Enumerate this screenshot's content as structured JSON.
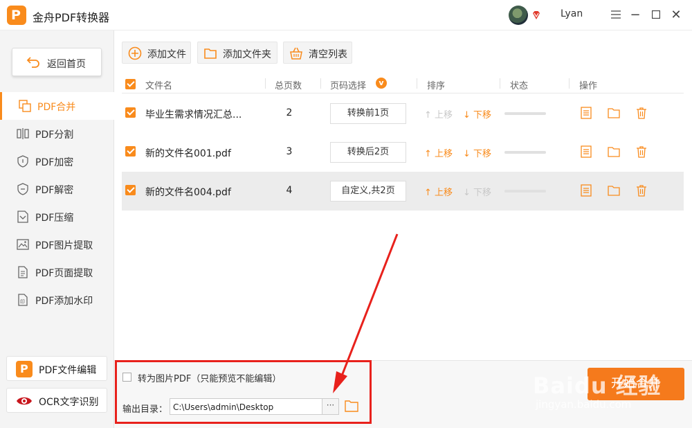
{
  "titlebar": {
    "app_title": "金舟PDF转换器",
    "username": "Lyan",
    "min_glyph": "−",
    "max_glyph": "☐",
    "close_glyph": "✕"
  },
  "sidebar": {
    "back_label": "返回首页",
    "items": [
      {
        "label": "PDF合并",
        "icon": "merge-icon",
        "active": true
      },
      {
        "label": "PDF分割",
        "icon": "split-icon"
      },
      {
        "label": "PDF加密",
        "icon": "shield-lock-icon"
      },
      {
        "label": "PDF解密",
        "icon": "shield-unlock-icon"
      },
      {
        "label": "PDF压缩",
        "icon": "compress-icon"
      },
      {
        "label": "PDF图片提取",
        "icon": "image-icon"
      },
      {
        "label": "PDF页面提取",
        "icon": "page-icon"
      },
      {
        "label": "PDF添加水印",
        "icon": "watermark-icon"
      }
    ],
    "tools": [
      {
        "label": "PDF文件编辑",
        "icon": "pdf-edit-icon"
      },
      {
        "label": "OCR文字识别",
        "icon": "eye-icon"
      }
    ]
  },
  "toolbar": {
    "add_file": "添加文件",
    "add_folder": "添加文件夹",
    "clear_list": "清空列表"
  },
  "table": {
    "headers": {
      "filename": "文件名",
      "pages": "总页数",
      "page_select": "页码选择",
      "order": "排序",
      "status": "状态",
      "actions": "操作"
    },
    "page_select_badge": "v",
    "move_up": "上移",
    "move_down": "下移",
    "rows": [
      {
        "name": "毕业生需求情况汇总...",
        "pages": "2",
        "page_range": "转换前1页",
        "up_enabled": false,
        "down_enabled": true,
        "selected": false
      },
      {
        "name": "新的文件名001.pdf",
        "pages": "3",
        "page_range": "转换后2页",
        "up_enabled": true,
        "down_enabled": true,
        "selected": false
      },
      {
        "name": "新的文件名004.pdf",
        "pages": "4",
        "page_range": "自定义,共2页",
        "up_enabled": true,
        "down_enabled": false,
        "selected": true
      }
    ]
  },
  "bottom": {
    "to_image_pdf_label": "转为图片PDF（只能预览不能编辑）",
    "output_dir_label": "输出目录：",
    "output_dir_value": "C:\\Users\\admin\\Desktop",
    "browse_label": "···",
    "start_label": "开始合并"
  },
  "watermark": {
    "brand": "Baidu 经验",
    "url": "jingyan.baidu.com"
  },
  "colors": {
    "accent": "#f98b1c",
    "annotation_red": "#e8211c"
  }
}
